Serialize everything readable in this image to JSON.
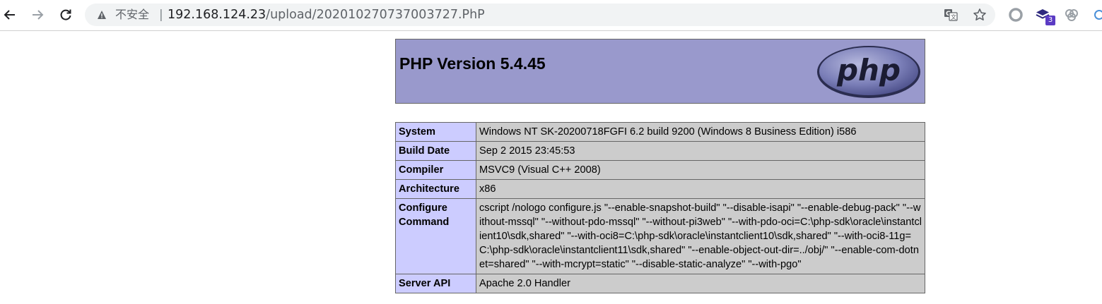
{
  "browser": {
    "security_label": "不安全",
    "separator": "|",
    "url_host": "192.168.124.23",
    "url_path": "/upload/202010270737003727.PhP",
    "extension_badge": "3",
    "icons": [
      "back-icon",
      "forward-icon",
      "reload-icon",
      "warning-icon",
      "translate-icon",
      "star-icon",
      "extension-circle-icon",
      "extension-stack-icon",
      "extension-link-icon"
    ]
  },
  "php": {
    "title": "PHP Version 5.4.45",
    "logo_text": "php",
    "colors": {
      "header_bg": "#9999cc",
      "label_bg": "#ccccff",
      "value_bg": "#cccccc",
      "border": "#666666"
    },
    "rows": [
      {
        "label": "System",
        "value": "Windows NT SK-20200718FGFI 6.2 build 9200 (Windows 8 Business Edition) i586"
      },
      {
        "label": "Build Date",
        "value": "Sep 2 2015 23:45:53"
      },
      {
        "label": "Compiler",
        "value": "MSVC9 (Visual C++ 2008)"
      },
      {
        "label": "Architecture",
        "value": "x86"
      },
      {
        "label": "Configure Command",
        "value": "cscript /nologo configure.js \"--enable-snapshot-build\" \"--disable-isapi\" \"--enable-debug-pack\" \"--without-mssql\" \"--without-pdo-mssql\" \"--without-pi3web\" \"--with-pdo-oci=C:\\php-sdk\\oracle\\instantclient10\\sdk,shared\" \"--with-oci8=C:\\php-sdk\\oracle\\instantclient10\\sdk,shared\" \"--with-oci8-11g=C:\\php-sdk\\oracle\\instantclient11\\sdk,shared\" \"--enable-object-out-dir=../obj/\" \"--enable-com-dotnet=shared\" \"--with-mcrypt=static\" \"--disable-static-analyze\" \"--with-pgo\""
      },
      {
        "label": "Server API",
        "value": "Apache 2.0 Handler"
      }
    ]
  }
}
